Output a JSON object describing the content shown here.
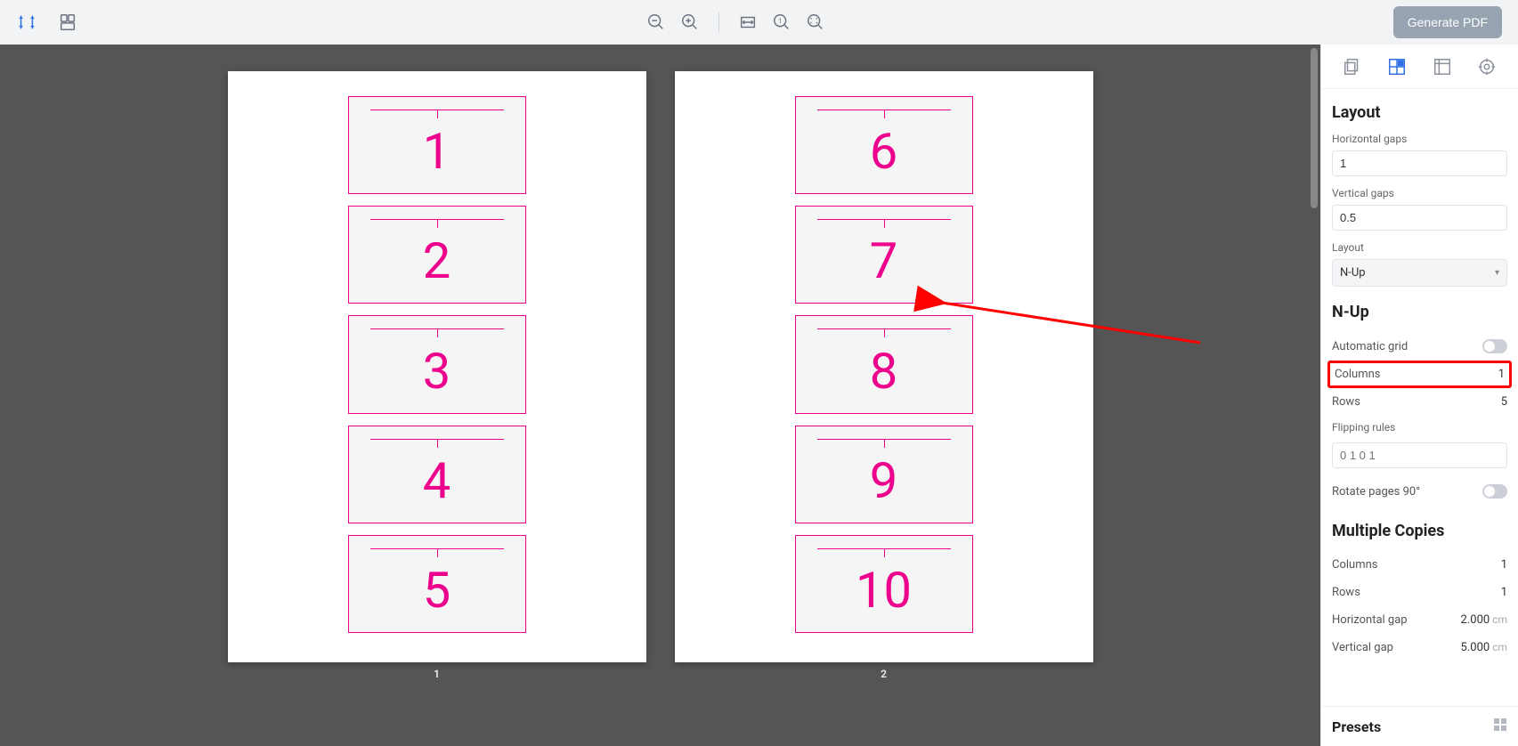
{
  "toolbar": {
    "generate_label": "Generate PDF"
  },
  "preview": {
    "pages": [
      {
        "label": "1",
        "cards": [
          "1",
          "2",
          "3",
          "4",
          "5"
        ]
      },
      {
        "label": "2",
        "cards": [
          "6",
          "7",
          "8",
          "9",
          "10"
        ]
      }
    ]
  },
  "panel": {
    "layout": {
      "title": "Layout",
      "hgaps_label": "Horizontal gaps",
      "hgaps_value": "1",
      "vgaps_label": "Vertical gaps",
      "vgaps_value": "0.5",
      "layout_label": "Layout",
      "layout_value": "N-Up"
    },
    "nup": {
      "title": "N-Up",
      "auto_label": "Automatic grid",
      "columns_label": "Columns",
      "columns_value": "1",
      "rows_label": "Rows",
      "rows_value": "5",
      "flip_label": "Flipping rules",
      "flip_placeholder": "0 1 0 1",
      "rotate_label": "Rotate pages 90°"
    },
    "multi": {
      "title": "Multiple Copies",
      "columns_label": "Columns",
      "columns_value": "1",
      "rows_label": "Rows",
      "rows_value": "1",
      "hgap_label": "Horizontal gap",
      "hgap_value": "2.000",
      "vgap_label": "Vertical gap",
      "vgap_value": "5.000",
      "unit": "cm"
    },
    "presets_title": "Presets"
  }
}
